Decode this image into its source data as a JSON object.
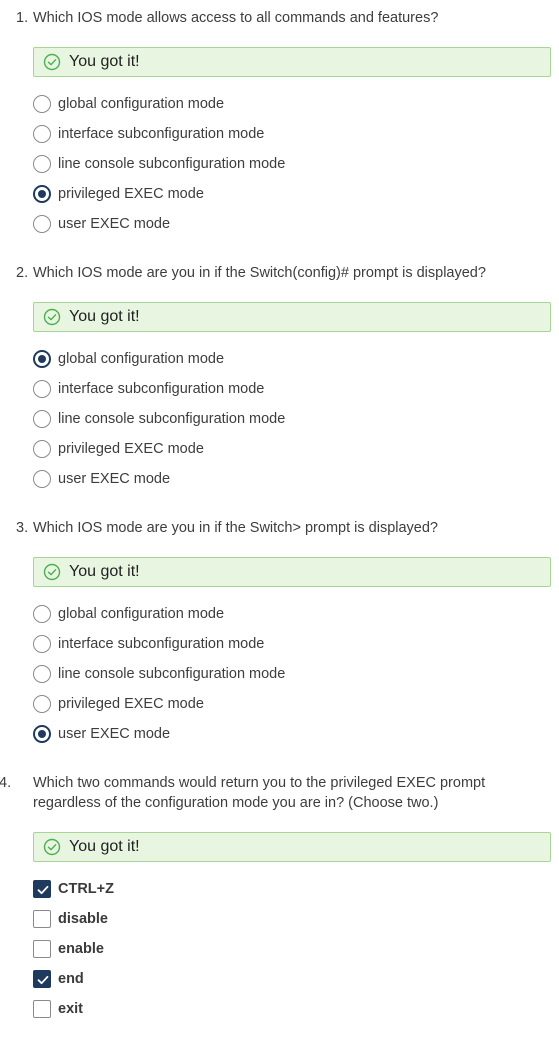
{
  "feedback_label": "You got it!",
  "questions": [
    {
      "number": "1.",
      "text": "Which IOS mode allows access to all commands and features?",
      "type": "radio",
      "options": [
        {
          "label": "global configuration mode",
          "selected": false
        },
        {
          "label": "interface subconfiguration mode",
          "selected": false
        },
        {
          "label": "line console subconfiguration mode",
          "selected": false
        },
        {
          "label": "privileged EXEC mode",
          "selected": true
        },
        {
          "label": "user EXEC mode",
          "selected": false
        }
      ]
    },
    {
      "number": "2.",
      "text": "Which IOS mode are you in if the Switch(config)# prompt is displayed?",
      "type": "radio",
      "options": [
        {
          "label": "global configuration mode",
          "selected": true
        },
        {
          "label": "interface subconfiguration mode",
          "selected": false
        },
        {
          "label": "line console subconfiguration mode",
          "selected": false
        },
        {
          "label": "privileged EXEC mode",
          "selected": false
        },
        {
          "label": "user EXEC mode",
          "selected": false
        }
      ]
    },
    {
      "number": "3.",
      "text": "Which IOS mode are you in if the Switch> prompt is displayed?",
      "type": "radio",
      "options": [
        {
          "label": "global configuration mode",
          "selected": false
        },
        {
          "label": "interface subconfiguration mode",
          "selected": false
        },
        {
          "label": "line console subconfiguration mode",
          "selected": false
        },
        {
          "label": "privileged EXEC mode",
          "selected": false
        },
        {
          "label": "user EXEC mode",
          "selected": true
        }
      ]
    },
    {
      "number": "4.",
      "text": "Which two commands would return you to the privileged EXEC prompt regardless of the configuration mode you are in? (Choose two.)",
      "type": "checkbox",
      "options": [
        {
          "label": "CTRL+Z",
          "selected": true
        },
        {
          "label": "disable",
          "selected": false
        },
        {
          "label": "enable",
          "selected": false
        },
        {
          "label": "end",
          "selected": true
        },
        {
          "label": "exit",
          "selected": false
        }
      ]
    }
  ],
  "colors": {
    "feedback_bg": "#e8f5e1",
    "feedback_border": "#a8d494",
    "success_icon": "#4caf50",
    "selected_control": "#1f3a5f"
  }
}
